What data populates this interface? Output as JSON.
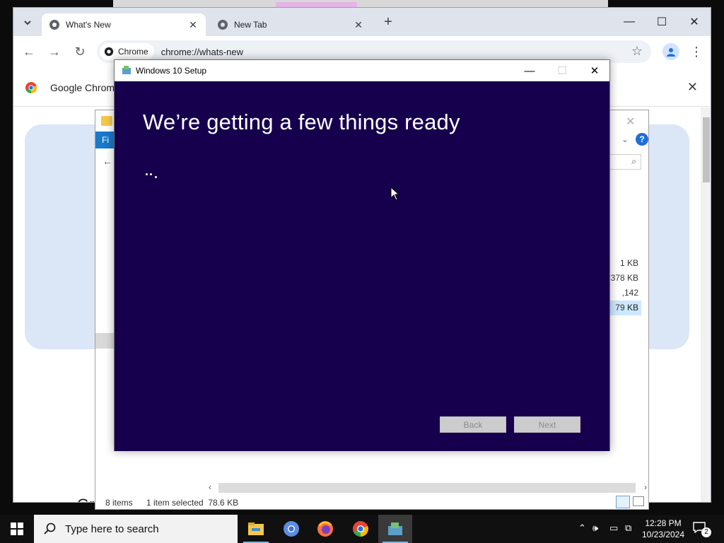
{
  "chrome": {
    "tabs": [
      {
        "title": "What's New",
        "active": true
      },
      {
        "title": "New Tab",
        "active": false
      }
    ],
    "chip_label": "Chrome",
    "url": "chrome://whats-new",
    "infobar_text": "Google Chrome",
    "page_bottom_text": "Gr"
  },
  "explorer": {
    "ribbon_file_tab": "Fi",
    "sizes": [
      "1 KB",
      "378 KB",
      ",142 KB",
      "79 KB"
    ],
    "status_items": "8 items",
    "status_selected": "1 item selected  78.6 KB"
  },
  "setup": {
    "window_title": "Windows 10 Setup",
    "heading": "We’re getting a few things ready",
    "back_label": "Back",
    "next_label": "Next",
    "background_color": "#16004e"
  },
  "taskbar": {
    "search_placeholder": "Type here to search",
    "apps": [
      "file-explorer",
      "chromium",
      "firefox",
      "chrome",
      "windows-setup"
    ],
    "clock_time": "12:28 PM",
    "clock_date": "10/23/2024",
    "notification_count": "2"
  }
}
